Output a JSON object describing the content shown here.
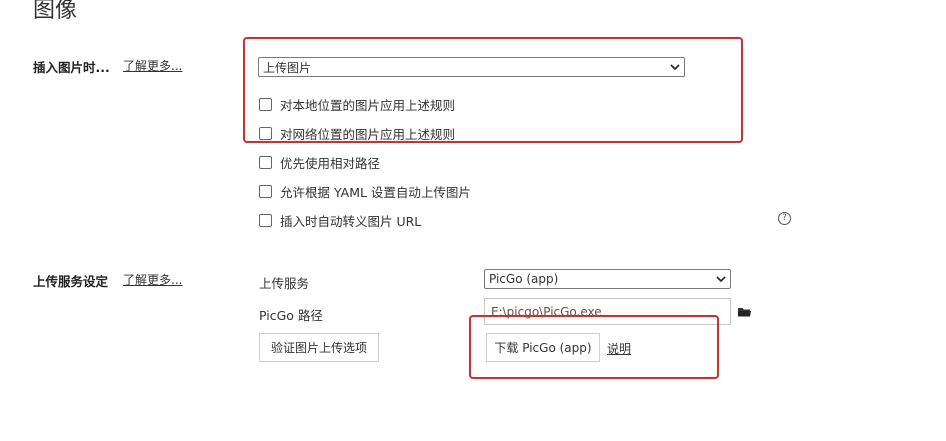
{
  "header": {
    "title": "图像"
  },
  "insert_section": {
    "label": "插入图片时...",
    "learn_more": "了解更多...",
    "select": {
      "value": "上传图片"
    },
    "checkboxes": [
      {
        "label": "对本地位置的图片应用上述规则",
        "checked": false
      },
      {
        "label": "对网络位置的图片应用上述规则",
        "checked": false
      },
      {
        "label": "优先使用相对路径",
        "checked": false
      },
      {
        "label": "允许根据 YAML 设置自动上传图片",
        "checked": false
      },
      {
        "label": "插入时自动转义图片 URL",
        "checked": false
      }
    ],
    "help_icon": "?"
  },
  "upload_section": {
    "label": "上传服务设定",
    "learn_more": "了解更多...",
    "service_label": "上传服务",
    "service_value": "PicGo (app)",
    "path_label": "PicGo 路径",
    "path_value": "E:\\picgo\\PicGo.exe",
    "verify_button": "验证图片上传选项",
    "download_button": "下载 PicGo (app)",
    "explain_link": "说明"
  },
  "annotations": {
    "highlight_color": "#e02828"
  }
}
